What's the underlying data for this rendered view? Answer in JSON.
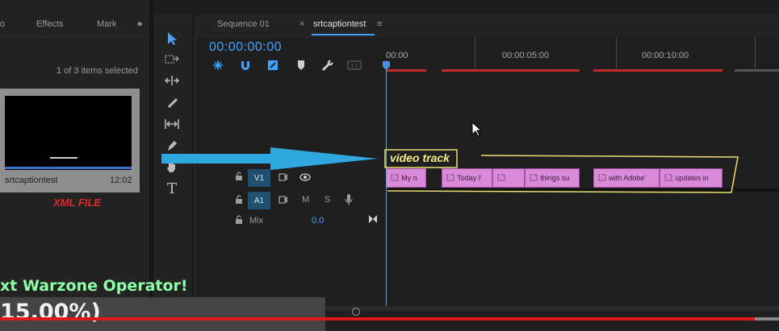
{
  "project_panel": {
    "tabs": [
      "o",
      "Effects",
      "Mark"
    ],
    "overflow": "»",
    "items_selected": "1 of 3 items selected",
    "item": {
      "name": "srtcaptiontest",
      "duration": "12:02"
    },
    "annotation": "XML FILE"
  },
  "tools": {
    "icons": [
      "selection-tool-icon",
      "track-select-icon",
      "ripple-edit-icon",
      "razor-icon",
      "slip-icon",
      "pen-icon",
      "hand-icon",
      "type-icon"
    ]
  },
  "timeline": {
    "tabs": [
      {
        "label": "Sequence 01",
        "active": false
      },
      {
        "label": "srtcaptiontest",
        "active": true
      }
    ],
    "close_glyph": "×",
    "menu_glyph": "≡",
    "timecode": "00:00:00:00",
    "ruler": [
      "00:00",
      "00:00:05:00",
      "00:00:10:00"
    ],
    "tracks": {
      "v1": {
        "label": "V1"
      },
      "a1": {
        "label": "A1",
        "m": "M",
        "s": "S"
      },
      "mix": {
        "label": "Mix",
        "value": "0.0"
      }
    },
    "clips": [
      {
        "text": "My n"
      },
      {
        "text": "Today I'"
      },
      {
        "text": ""
      },
      {
        "text": "things su"
      },
      {
        "text": "with Adobe'"
      },
      {
        "text": "updates in"
      }
    ],
    "fx_label": "fx",
    "annotation": "video track"
  },
  "overlay": {
    "line1": "xt Warzone Operator!",
    "line2": "15.00%)"
  },
  "colors": {
    "accent": "#3ea3ff",
    "clip": "#d98ad8",
    "annotation_yellow": "#f6f08a",
    "annotation_red": "#e02828",
    "arrow": "#2fa8e0"
  }
}
